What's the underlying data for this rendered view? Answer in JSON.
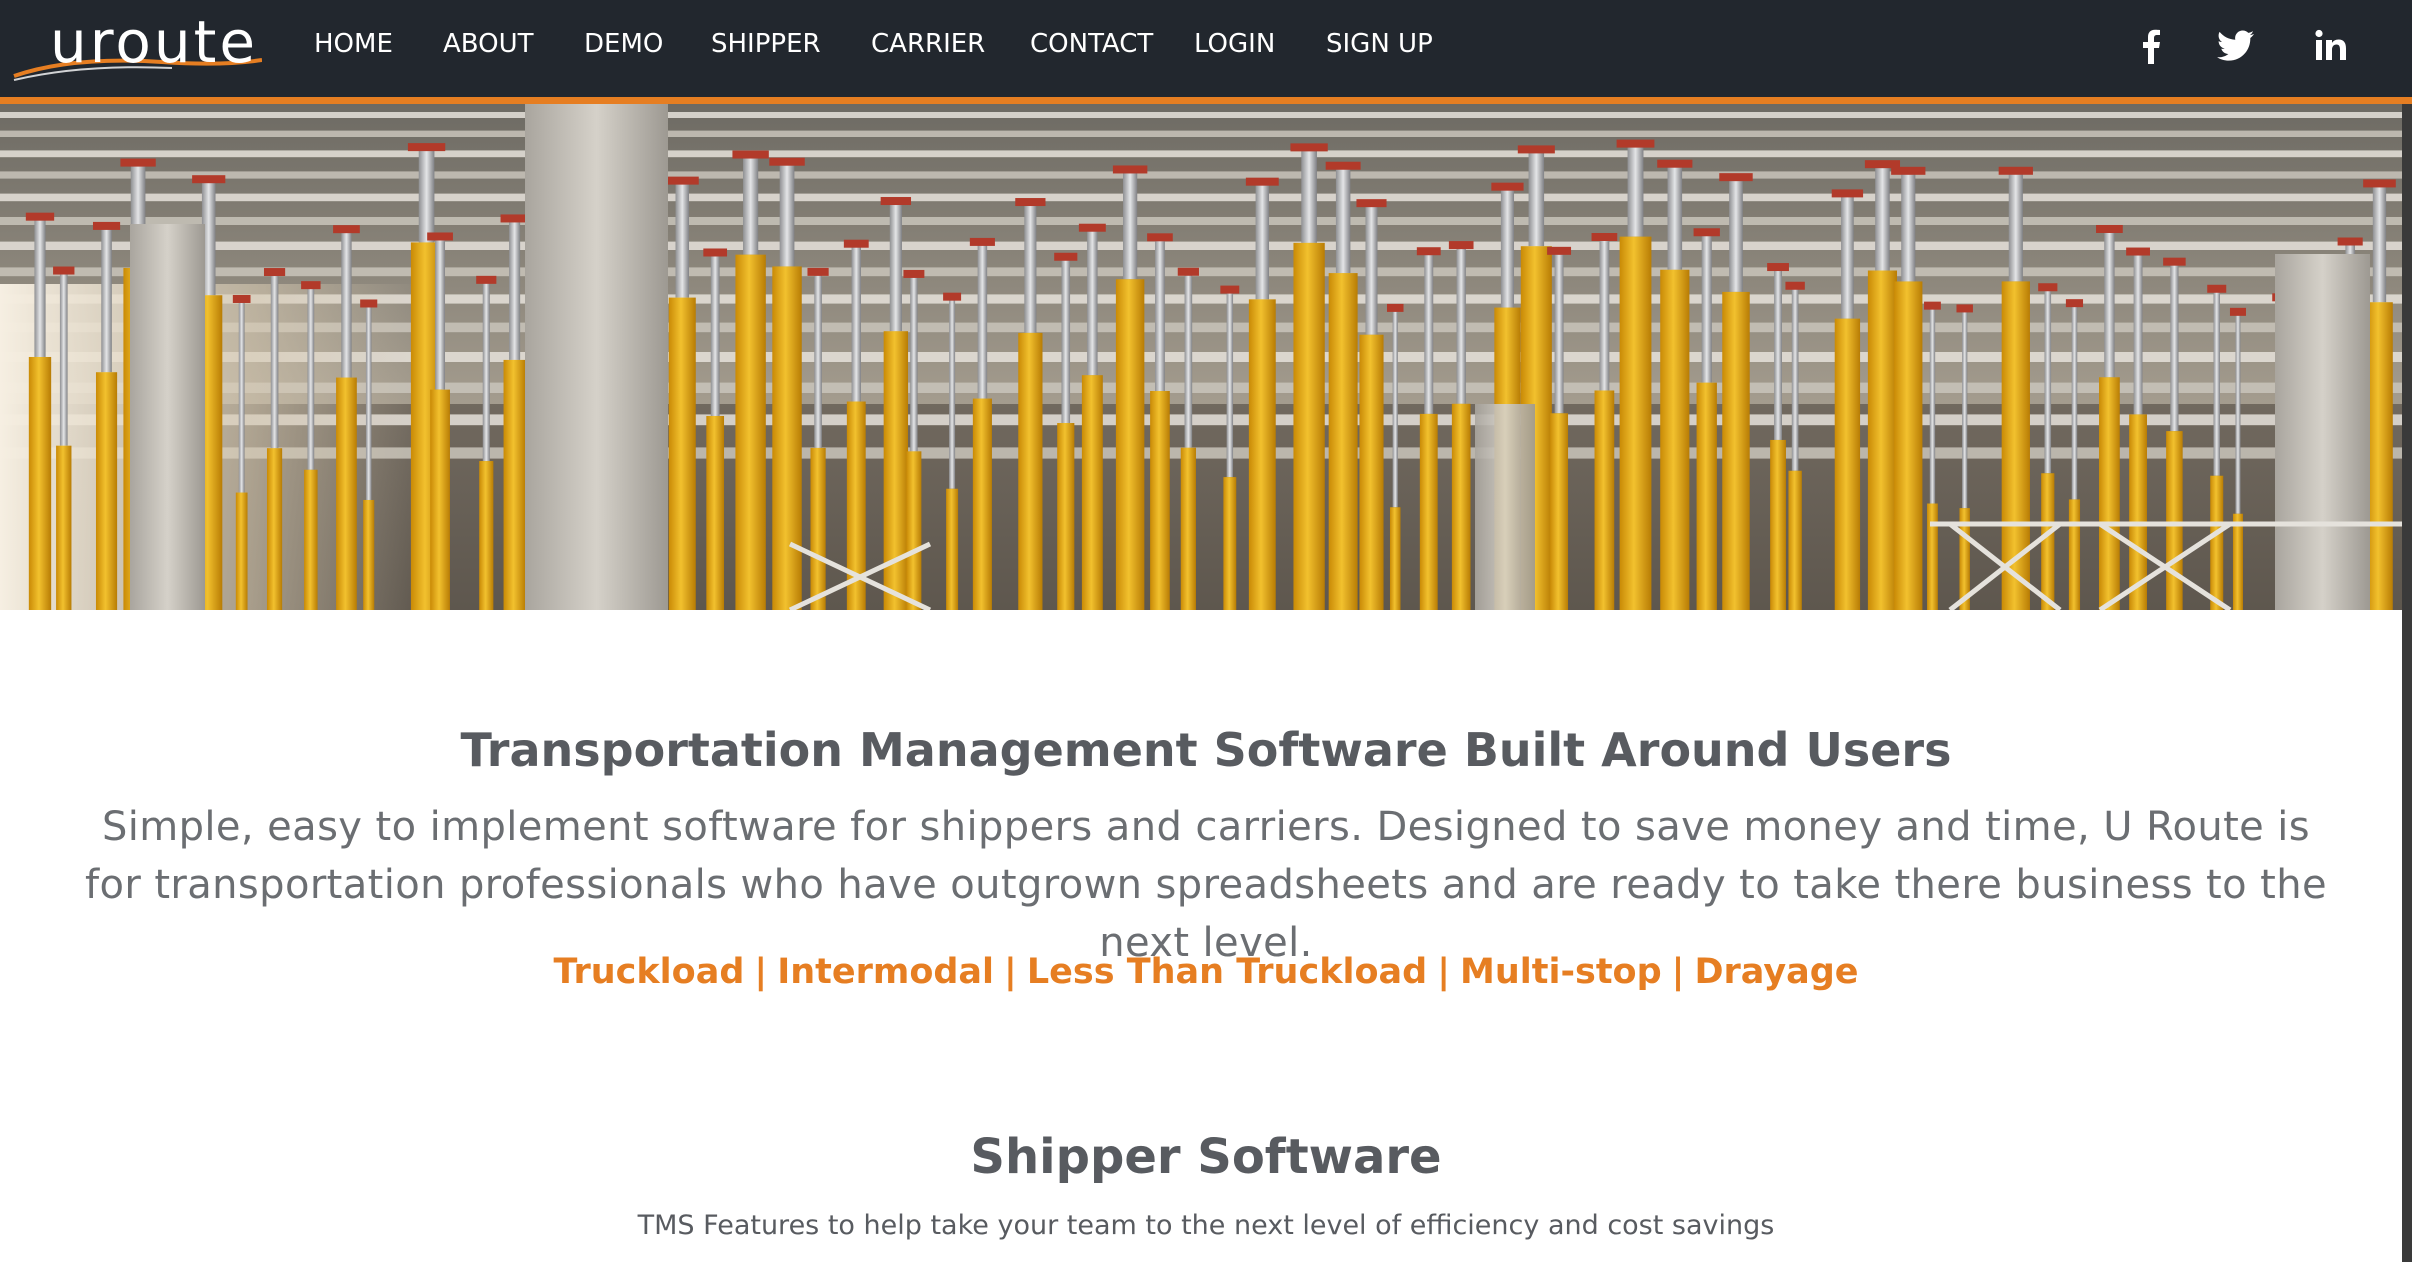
{
  "brand": {
    "logo_text": "uroute"
  },
  "nav": {
    "items": [
      {
        "label": "HOME"
      },
      {
        "label": "ABOUT"
      },
      {
        "label": "DEMO"
      },
      {
        "label": "SHIPPER"
      },
      {
        "label": "CARRIER"
      },
      {
        "label": "CONTACT"
      },
      {
        "label": "LOGIN"
      },
      {
        "label": "SIGN UP"
      }
    ],
    "social": [
      "facebook-icon",
      "twitter-icon",
      "linkedin-icon"
    ]
  },
  "colors": {
    "nav_bg": "#22272e",
    "accent": "#e67e22",
    "heading": "#585b60",
    "body_text": "#6b6e72"
  },
  "intro": {
    "title": "Transportation Management Software Built Around Users",
    "body": "Simple, easy to implement software for shippers and carriers. Designed to save money and time, U Route is for transportation professionals who have outgrown spreadsheets and are ready to take there business to the next level."
  },
  "services": [
    "Truckload",
    "Intermodal",
    "Less Than Truckload",
    "Multi-stop",
    "Drayage"
  ],
  "shipper": {
    "title": "Shipper Software",
    "subtitle": "TMS Features to help take your team to the next level of efficiency and cost savings"
  }
}
